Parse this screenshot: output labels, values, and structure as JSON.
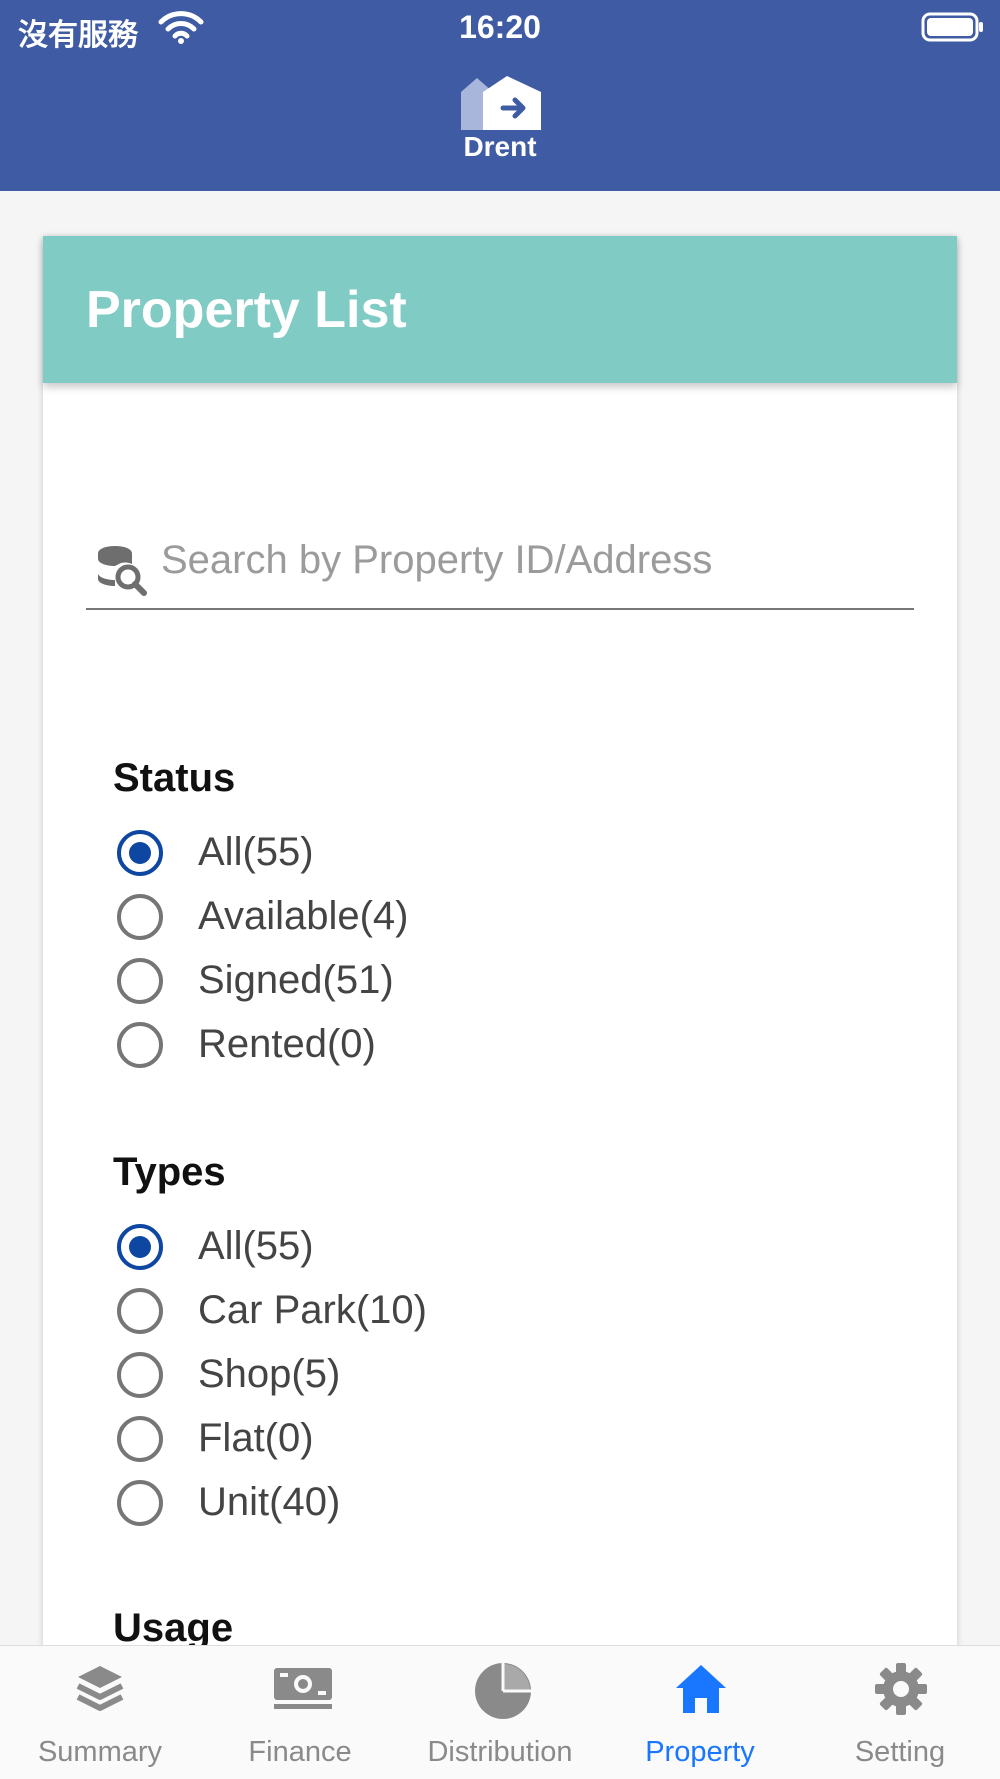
{
  "status_bar": {
    "carrier": "沒有服務",
    "time": "16:20"
  },
  "app": {
    "logo_text": "Drent"
  },
  "card": {
    "title": "Property List"
  },
  "search": {
    "placeholder": "Search by Property ID/Address",
    "value": ""
  },
  "filters": {
    "status": {
      "title": "Status",
      "options": [
        {
          "label": "All(55)",
          "selected": true
        },
        {
          "label": "Available(4)",
          "selected": false
        },
        {
          "label": "Signed(51)",
          "selected": false
        },
        {
          "label": "Rented(0)",
          "selected": false
        }
      ]
    },
    "types": {
      "title": "Types",
      "options": [
        {
          "label": "All(55)",
          "selected": true
        },
        {
          "label": "Car Park(10)",
          "selected": false
        },
        {
          "label": "Shop(5)",
          "selected": false
        },
        {
          "label": "Flat(0)",
          "selected": false
        },
        {
          "label": "Unit(40)",
          "selected": false
        }
      ]
    },
    "usage": {
      "title": "Usage"
    }
  },
  "tabs": [
    {
      "label": "Summary",
      "icon": "layers-icon",
      "active": false
    },
    {
      "label": "Finance",
      "icon": "banknote-icon",
      "active": false
    },
    {
      "label": "Distribution",
      "icon": "pie-chart-icon",
      "active": false
    },
    {
      "label": "Property",
      "icon": "home-icon",
      "active": true
    },
    {
      "label": "Setting",
      "icon": "gear-icon",
      "active": false
    }
  ],
  "colors": {
    "header": "#3f5ba3",
    "card_header": "#80cbc4",
    "radio_selected": "#0d47a1",
    "tab_active": "#1976ff",
    "tab_inactive": "#8a8a8a"
  }
}
